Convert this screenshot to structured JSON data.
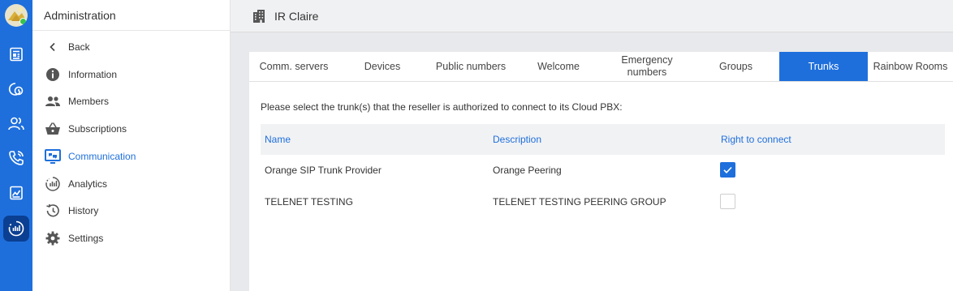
{
  "sidebar": {
    "title": "Administration",
    "items": [
      {
        "label": "Back",
        "icon": "chevron-left-icon"
      },
      {
        "label": "Information",
        "icon": "info-icon"
      },
      {
        "label": "Members",
        "icon": "members-icon"
      },
      {
        "label": "Subscriptions",
        "icon": "basket-icon"
      },
      {
        "label": "Communication",
        "icon": "communication-icon",
        "active": true
      },
      {
        "label": "Analytics",
        "icon": "analytics-icon"
      },
      {
        "label": "History",
        "icon": "history-icon"
      },
      {
        "label": "Settings",
        "icon": "gear-icon"
      }
    ]
  },
  "header": {
    "title": "IR Claire",
    "icon": "building-icon"
  },
  "tabs": [
    {
      "label": "Comm. servers"
    },
    {
      "label": "Devices"
    },
    {
      "label": "Public numbers"
    },
    {
      "label": "Welcome"
    },
    {
      "label": "Emergency numbers"
    },
    {
      "label": "Groups"
    },
    {
      "label": "Trunks",
      "active": true
    },
    {
      "label": "Rainbow Rooms"
    }
  ],
  "content": {
    "intro": "Please select the trunk(s) that the reseller is authorized to connect to its Cloud PBX:",
    "columns": [
      "Name",
      "Description",
      "Right to connect"
    ],
    "rows": [
      {
        "name": "Orange SIP Trunk Provider",
        "description": "Orange Peering",
        "right_to_connect": true
      },
      {
        "name": "TELENET TESTING",
        "description": "TELENET TESTING PEERING GROUP",
        "right_to_connect": false
      }
    ]
  },
  "colors": {
    "accent": "#1e6fdc",
    "rail": "#1e6fdc",
    "rail_active": "#0b3f92"
  }
}
